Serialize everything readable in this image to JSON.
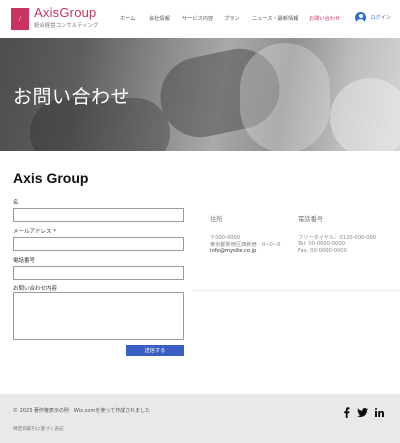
{
  "header": {
    "logo_icon": "slash-logo-icon",
    "brand_name": "AxisGroup",
    "brand_sub": "統合経営コンサルティング",
    "nav": [
      {
        "label": "ホーム",
        "active": false
      },
      {
        "label": "会社情報",
        "active": false
      },
      {
        "label": "サービス内容",
        "active": false
      },
      {
        "label": "プラン",
        "active": false
      },
      {
        "label": "ニュース・最新情報",
        "active": false
      },
      {
        "label": "お問い合わせ",
        "active": true
      }
    ],
    "login_label": "ログイン"
  },
  "hero": {
    "title": "お問い合わせ"
  },
  "form": {
    "company": "Axis Group",
    "name_label": "名",
    "email_label": "メールアドレス *",
    "phone_label": "電話番号",
    "message_label": "お問い合わせ内容",
    "submit_label": "送信する"
  },
  "info": {
    "address_head": "住所",
    "address_lines": [
      "〒000-0000",
      "東京都新宿区西新宿　0−0−0",
      "info@mysite.co.jp"
    ],
    "phone_head": "電話番号",
    "phone_lines": [
      "フリーダイヤル：0120-000-000",
      "Tel: 00-0000-0000",
      "Fax: 00-0000-0000"
    ]
  },
  "footer": {
    "copyright": "© 2023 著作権表示の例　Wix.comを使って作成されました",
    "note": "特定商取引に基づく表記",
    "social": [
      "facebook-icon",
      "twitter-icon",
      "linkedin-icon"
    ]
  },
  "colors": {
    "brand": "#c9345e",
    "accent": "#3a5fc4",
    "login": "#2f6fd1"
  }
}
